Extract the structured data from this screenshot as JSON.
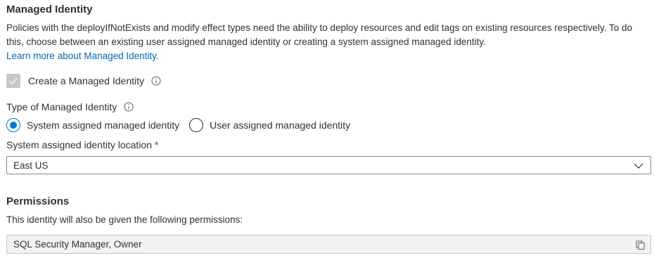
{
  "managed_identity": {
    "title": "Managed Identity",
    "description": "Policies with the deployIfNotExists and modify effect types need the ability to deploy resources and edit tags on existing resources respectively. To do this, choose between an existing user assigned managed identity or creating a system assigned managed identity.",
    "learn_more": "Learn more about Managed Identity.",
    "create_checkbox_label": "Create a Managed Identity",
    "create_checked": true,
    "type_label": "Type of Managed Identity",
    "type_options": [
      {
        "label": "System assigned managed identity",
        "selected": true
      },
      {
        "label": "User assigned managed identity",
        "selected": false
      }
    ],
    "location_label": "System assigned identity location",
    "location_required_marker": "*",
    "location_value": "East US"
  },
  "permissions": {
    "title": "Permissions",
    "description": "This identity will also be given the following permissions:",
    "value": "SQL Security Manager, Owner"
  },
  "colors": {
    "accent": "#0078d4",
    "link": "#0067b8",
    "required": "#a4262c",
    "disabled_checkbox": "#c8c6c4"
  },
  "icons": [
    "checkmark-icon",
    "info-icon",
    "chevron-down-icon",
    "copy-icon"
  ]
}
